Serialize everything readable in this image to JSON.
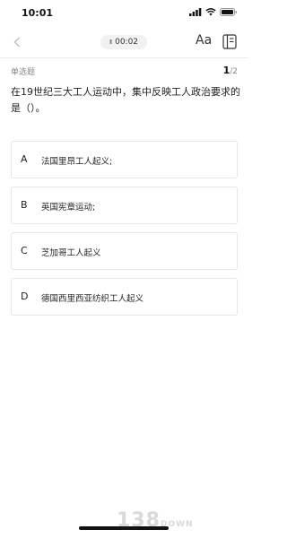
{
  "status": {
    "time": "10:01"
  },
  "timer": {
    "value": "00:02",
    "pause_glyph": "II"
  },
  "toolbar": {
    "font_label": "Aa"
  },
  "question": {
    "type": "单选题",
    "current": "1",
    "total": "/2",
    "text": "在19世纪三大工人运动中，集中反映工人政治要求的是（）。"
  },
  "options": [
    {
      "letter": "A",
      "text": "法国里昂工人起义;"
    },
    {
      "letter": "B",
      "text": "英国宪章运动;"
    },
    {
      "letter": "C",
      "text": "芝加哥工人起义"
    },
    {
      "letter": "D",
      "text": "德国西里西亚纺织工人起义"
    }
  ],
  "watermark": {
    "main": "138",
    "sub": "DOWN"
  }
}
